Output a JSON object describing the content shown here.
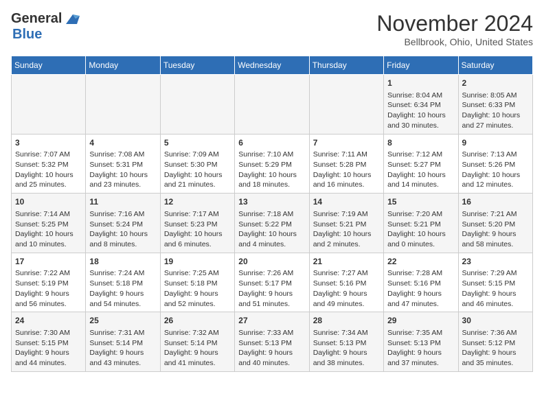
{
  "header": {
    "logo_line1": "General",
    "logo_line2": "Blue",
    "month": "November 2024",
    "location": "Bellbrook, Ohio, United States"
  },
  "weekdays": [
    "Sunday",
    "Monday",
    "Tuesday",
    "Wednesday",
    "Thursday",
    "Friday",
    "Saturday"
  ],
  "weeks": [
    [
      {
        "day": "",
        "info": ""
      },
      {
        "day": "",
        "info": ""
      },
      {
        "day": "",
        "info": ""
      },
      {
        "day": "",
        "info": ""
      },
      {
        "day": "",
        "info": ""
      },
      {
        "day": "1",
        "info": "Sunrise: 8:04 AM\nSunset: 6:34 PM\nDaylight: 10 hours and 30 minutes."
      },
      {
        "day": "2",
        "info": "Sunrise: 8:05 AM\nSunset: 6:33 PM\nDaylight: 10 hours and 27 minutes."
      }
    ],
    [
      {
        "day": "3",
        "info": "Sunrise: 7:07 AM\nSunset: 5:32 PM\nDaylight: 10 hours and 25 minutes."
      },
      {
        "day": "4",
        "info": "Sunrise: 7:08 AM\nSunset: 5:31 PM\nDaylight: 10 hours and 23 minutes."
      },
      {
        "day": "5",
        "info": "Sunrise: 7:09 AM\nSunset: 5:30 PM\nDaylight: 10 hours and 21 minutes."
      },
      {
        "day": "6",
        "info": "Sunrise: 7:10 AM\nSunset: 5:29 PM\nDaylight: 10 hours and 18 minutes."
      },
      {
        "day": "7",
        "info": "Sunrise: 7:11 AM\nSunset: 5:28 PM\nDaylight: 10 hours and 16 minutes."
      },
      {
        "day": "8",
        "info": "Sunrise: 7:12 AM\nSunset: 5:27 PM\nDaylight: 10 hours and 14 minutes."
      },
      {
        "day": "9",
        "info": "Sunrise: 7:13 AM\nSunset: 5:26 PM\nDaylight: 10 hours and 12 minutes."
      }
    ],
    [
      {
        "day": "10",
        "info": "Sunrise: 7:14 AM\nSunset: 5:25 PM\nDaylight: 10 hours and 10 minutes."
      },
      {
        "day": "11",
        "info": "Sunrise: 7:16 AM\nSunset: 5:24 PM\nDaylight: 10 hours and 8 minutes."
      },
      {
        "day": "12",
        "info": "Sunrise: 7:17 AM\nSunset: 5:23 PM\nDaylight: 10 hours and 6 minutes."
      },
      {
        "day": "13",
        "info": "Sunrise: 7:18 AM\nSunset: 5:22 PM\nDaylight: 10 hours and 4 minutes."
      },
      {
        "day": "14",
        "info": "Sunrise: 7:19 AM\nSunset: 5:21 PM\nDaylight: 10 hours and 2 minutes."
      },
      {
        "day": "15",
        "info": "Sunrise: 7:20 AM\nSunset: 5:21 PM\nDaylight: 10 hours and 0 minutes."
      },
      {
        "day": "16",
        "info": "Sunrise: 7:21 AM\nSunset: 5:20 PM\nDaylight: 9 hours and 58 minutes."
      }
    ],
    [
      {
        "day": "17",
        "info": "Sunrise: 7:22 AM\nSunset: 5:19 PM\nDaylight: 9 hours and 56 minutes."
      },
      {
        "day": "18",
        "info": "Sunrise: 7:24 AM\nSunset: 5:18 PM\nDaylight: 9 hours and 54 minutes."
      },
      {
        "day": "19",
        "info": "Sunrise: 7:25 AM\nSunset: 5:18 PM\nDaylight: 9 hours and 52 minutes."
      },
      {
        "day": "20",
        "info": "Sunrise: 7:26 AM\nSunset: 5:17 PM\nDaylight: 9 hours and 51 minutes."
      },
      {
        "day": "21",
        "info": "Sunrise: 7:27 AM\nSunset: 5:16 PM\nDaylight: 9 hours and 49 minutes."
      },
      {
        "day": "22",
        "info": "Sunrise: 7:28 AM\nSunset: 5:16 PM\nDaylight: 9 hours and 47 minutes."
      },
      {
        "day": "23",
        "info": "Sunrise: 7:29 AM\nSunset: 5:15 PM\nDaylight: 9 hours and 46 minutes."
      }
    ],
    [
      {
        "day": "24",
        "info": "Sunrise: 7:30 AM\nSunset: 5:15 PM\nDaylight: 9 hours and 44 minutes."
      },
      {
        "day": "25",
        "info": "Sunrise: 7:31 AM\nSunset: 5:14 PM\nDaylight: 9 hours and 43 minutes."
      },
      {
        "day": "26",
        "info": "Sunrise: 7:32 AM\nSunset: 5:14 PM\nDaylight: 9 hours and 41 minutes."
      },
      {
        "day": "27",
        "info": "Sunrise: 7:33 AM\nSunset: 5:13 PM\nDaylight: 9 hours and 40 minutes."
      },
      {
        "day": "28",
        "info": "Sunrise: 7:34 AM\nSunset: 5:13 PM\nDaylight: 9 hours and 38 minutes."
      },
      {
        "day": "29",
        "info": "Sunrise: 7:35 AM\nSunset: 5:13 PM\nDaylight: 9 hours and 37 minutes."
      },
      {
        "day": "30",
        "info": "Sunrise: 7:36 AM\nSunset: 5:12 PM\nDaylight: 9 hours and 35 minutes."
      }
    ]
  ]
}
